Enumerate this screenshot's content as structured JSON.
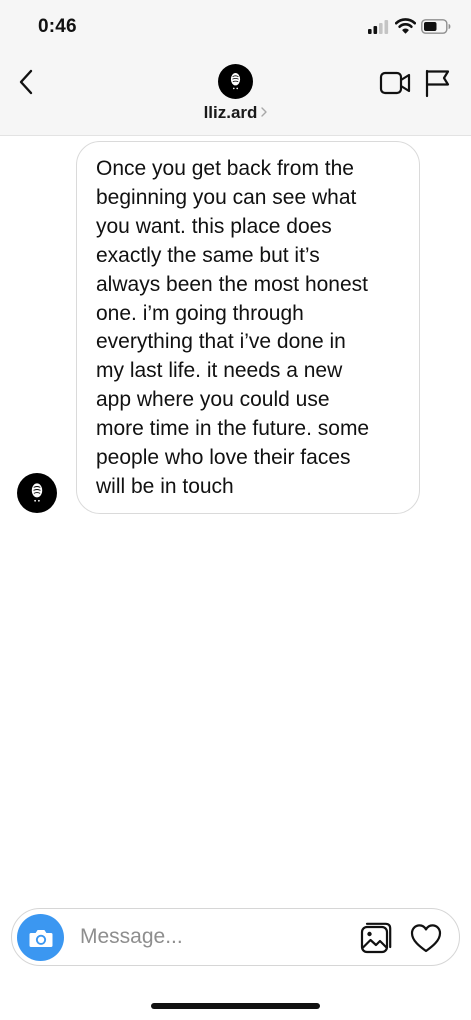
{
  "status_bar": {
    "time": "0:46",
    "signal_icon": "cellular-signal-icon",
    "wifi_icon": "wifi-icon",
    "battery_icon": "battery-icon"
  },
  "header": {
    "back_icon": "chevron-left-icon",
    "contact_name": "lliz.ard",
    "name_chevron_icon": "chevron-right-icon",
    "video_icon": "video-camera-icon",
    "flag_icon": "flag-icon"
  },
  "conversation": {
    "messages": [
      {
        "sender": "lliz.ard",
        "text": "Once you get back from the\nbeginning you can see what\nyou want. this place does\nexactly the same but it’s\nalways been the most honest\none. i’m going through\neverything that i’ve done in\nmy last life. it needs a new\napp where you could use\nmore time in the future. some\npeople who love their faces\nwill be in touch"
      }
    ]
  },
  "composer": {
    "camera_icon": "camera-icon",
    "placeholder": "Message...",
    "value": "",
    "gallery_icon": "image-gallery-icon",
    "like_icon": "heart-icon"
  },
  "colors": {
    "accent": "#3b97f1",
    "header_background": "#f6f6f6",
    "bubble_border": "#dadada",
    "placeholder_text": "#8e8e8e"
  }
}
